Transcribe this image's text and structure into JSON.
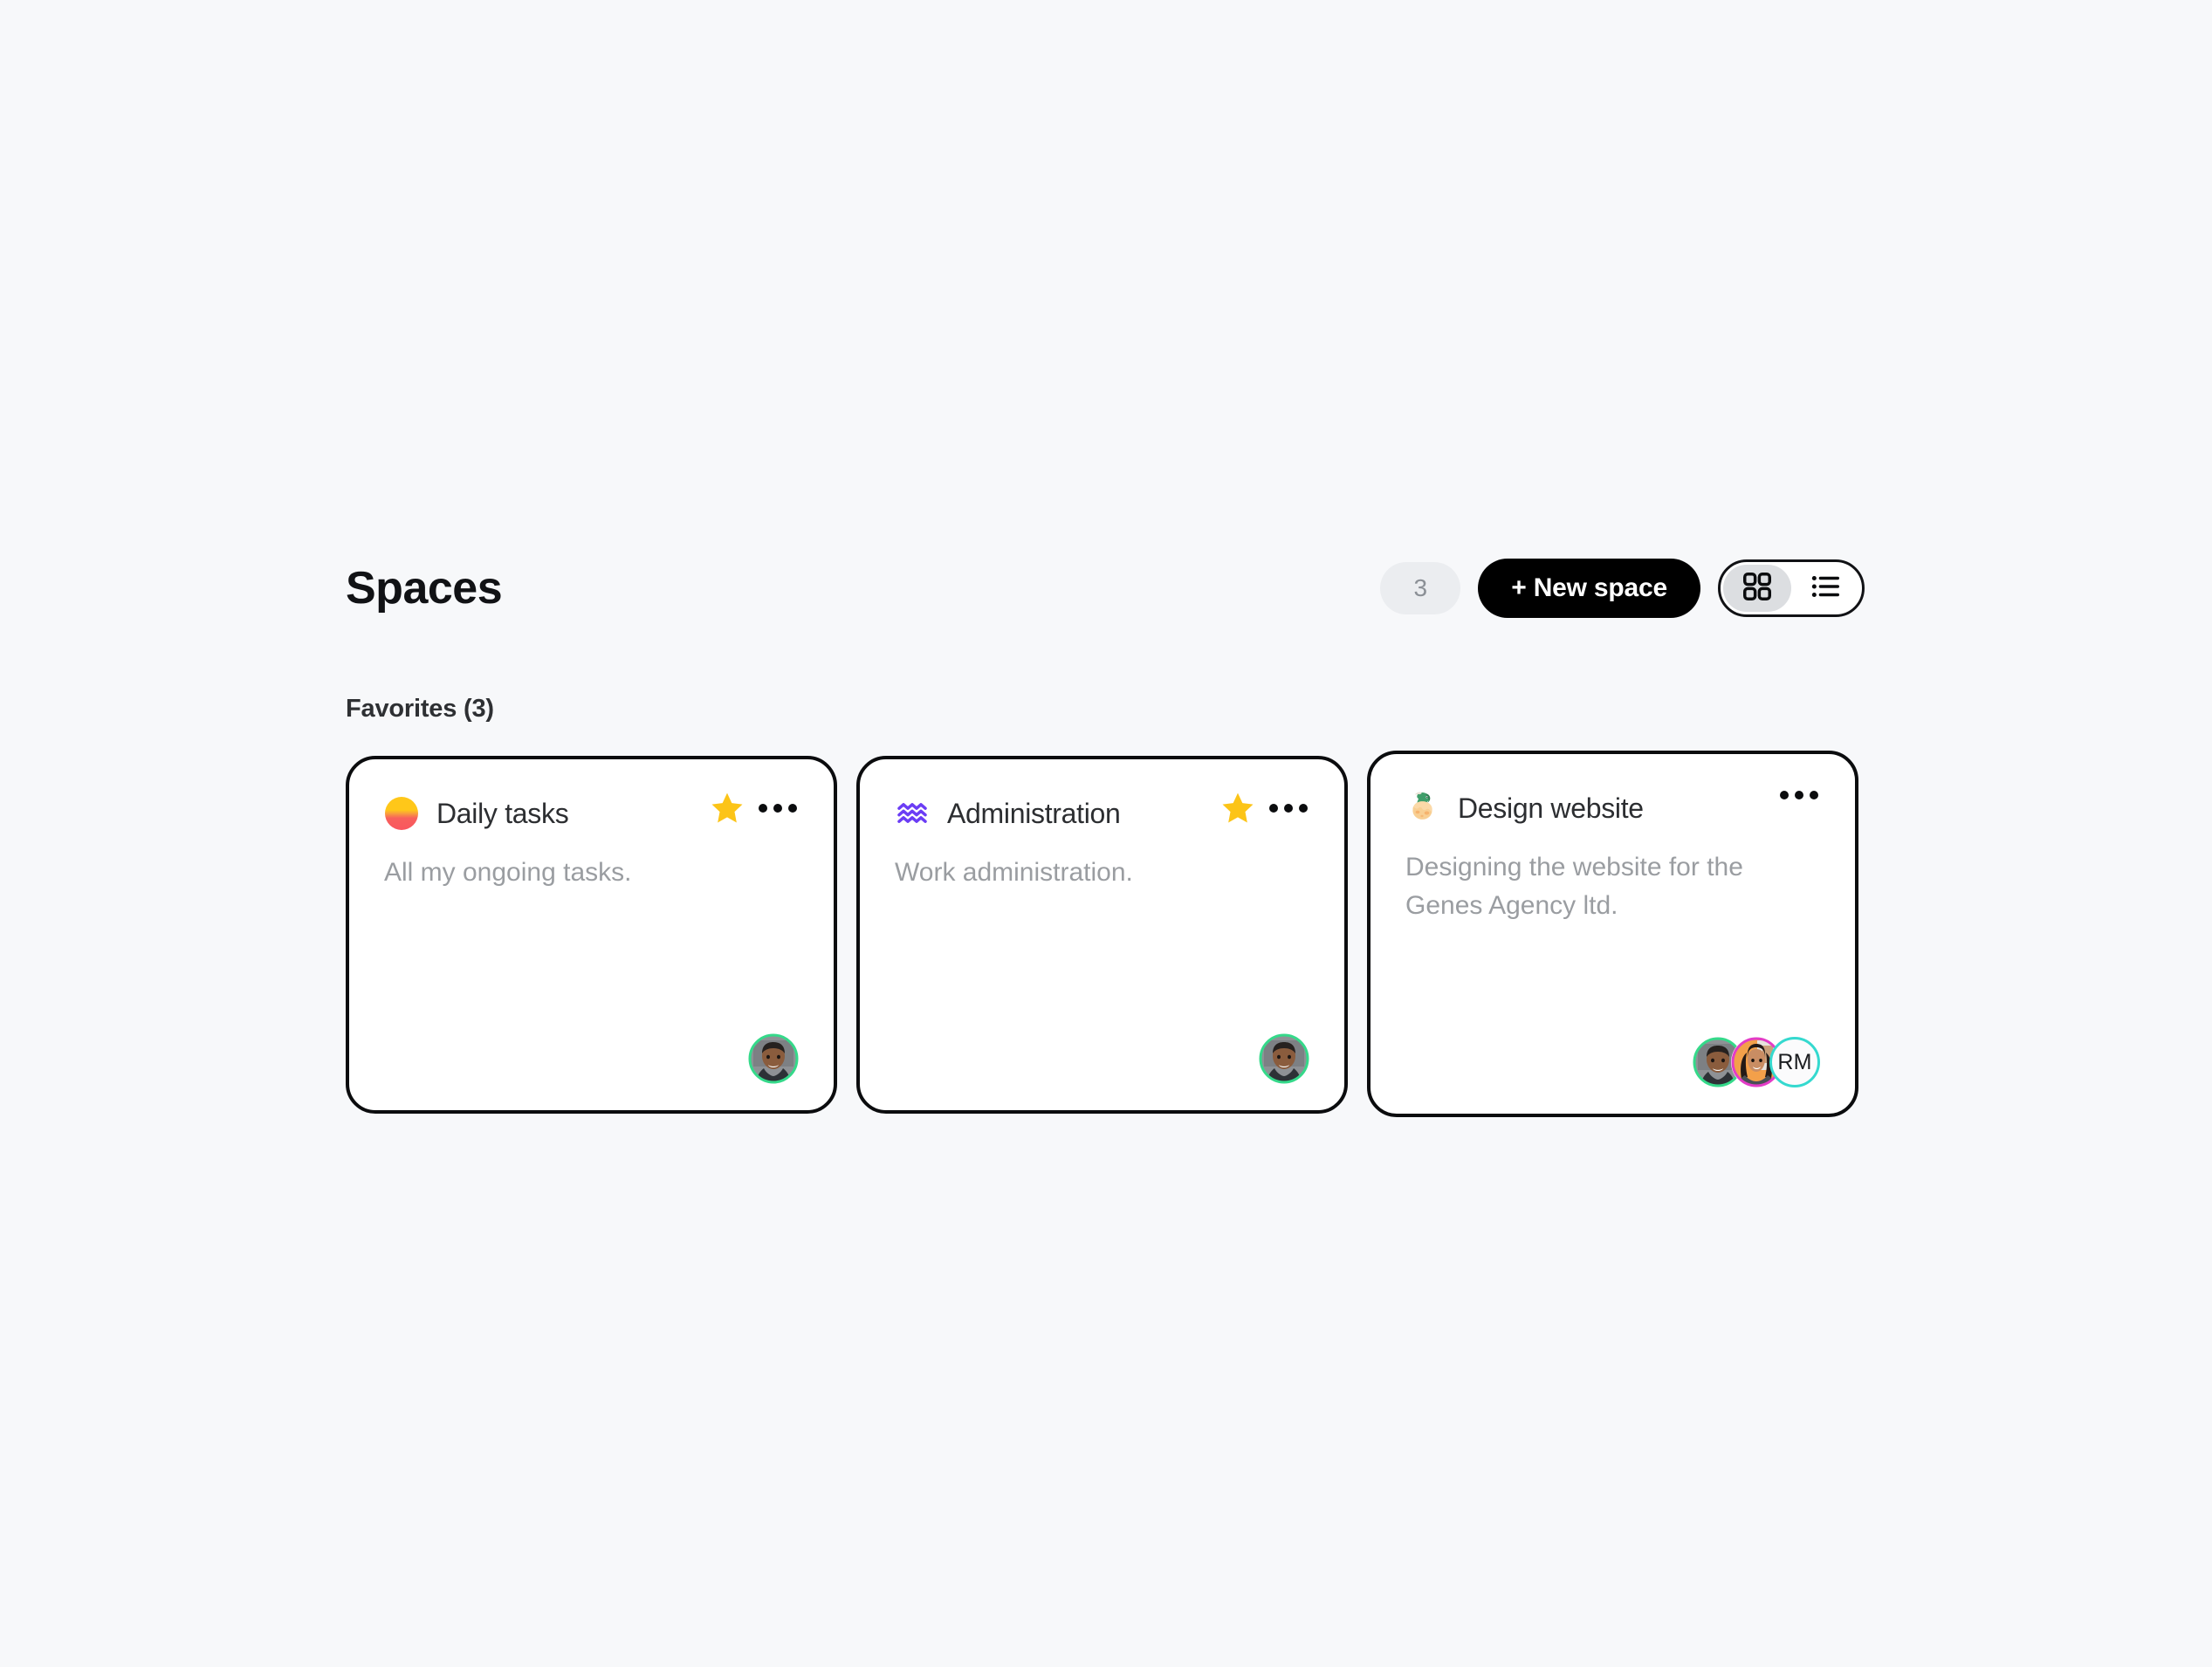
{
  "header": {
    "title": "Spaces",
    "count_badge": "3",
    "new_space_label": "+ New space",
    "view_toggle": {
      "grid_icon": "grid-view-icon",
      "list_icon": "list-view-icon",
      "active": "grid"
    }
  },
  "section": {
    "label": "Favorites (3)"
  },
  "cards": [
    {
      "emoji_name": "sunrise-emoji",
      "title": "Daily tasks",
      "description": "All my ongoing tasks.",
      "favorited": true,
      "star_icon": "star-icon",
      "menu_icon": "more-options-icon",
      "members": [
        {
          "type": "photo",
          "name": "member-avatar-photo-1",
          "ring_color": "#35d98a"
        }
      ]
    },
    {
      "emoji_name": "aquarius-emoji",
      "title": "Administration",
      "description": "Work administration.",
      "favorited": true,
      "star_icon": "star-icon",
      "menu_icon": "more-options-icon",
      "members": [
        {
          "type": "photo",
          "name": "member-avatar-photo-1",
          "ring_color": "#35d98a"
        }
      ]
    },
    {
      "emoji_name": "hatching-dino-emoji",
      "title": "Design website",
      "description": "Designing the website for the Genes Agency ltd.",
      "favorited": false,
      "star_icon": "star-icon",
      "menu_icon": "more-options-icon",
      "members": [
        {
          "type": "photo",
          "name": "member-avatar-photo-1",
          "ring_color": "#35d98a"
        },
        {
          "type": "photo",
          "name": "member-avatar-photo-2",
          "ring_color": "#e33cc7"
        },
        {
          "type": "initials",
          "name": "member-avatar-initials",
          "initials": "RM",
          "ring_color": "#35d9cf"
        }
      ]
    }
  ],
  "colors": {
    "page_background": "#f7f8fa",
    "card_border": "#0b0c0e",
    "card_background": "#ffffff",
    "accent_button": "#000000",
    "star": "#fcc417",
    "muted_text": "#9a9da1",
    "badge_background": "#ebedf0"
  }
}
